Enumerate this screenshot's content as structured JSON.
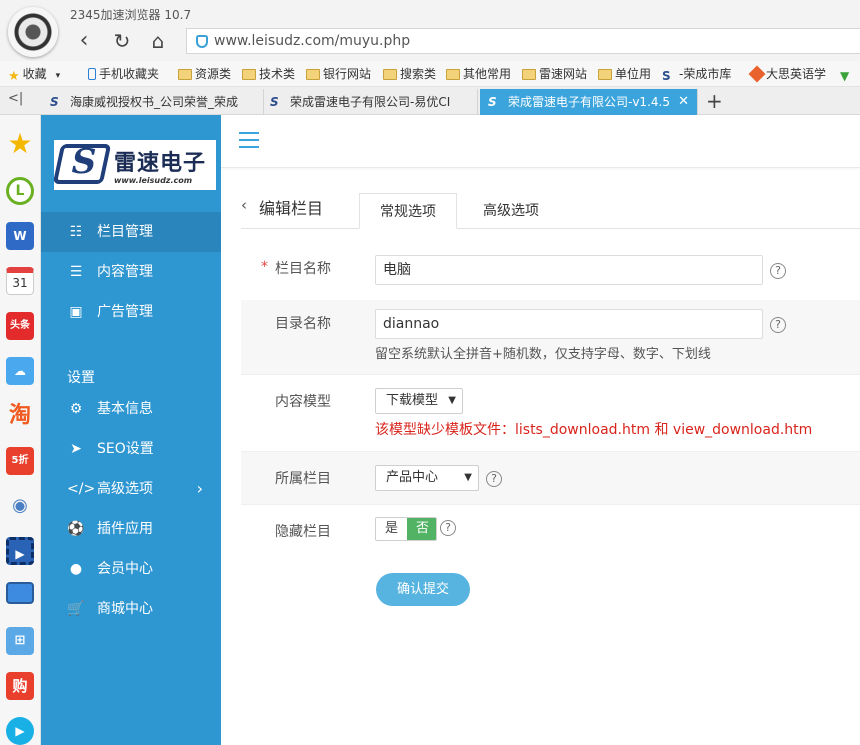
{
  "browser": {
    "title": "2345加速浏览器 10.7",
    "url": "www.leisudz.com/muyu.php"
  },
  "bookmarks": [
    {
      "label": "收藏",
      "icon": "star-icon"
    },
    {
      "label": "手机收藏夹",
      "icon": "phone-icon"
    },
    {
      "label": "资源类",
      "icon": "folder-icon"
    },
    {
      "label": "技术类",
      "icon": "folder-icon"
    },
    {
      "label": "银行网站",
      "icon": "folder-icon"
    },
    {
      "label": "搜索类",
      "icon": "folder-icon"
    },
    {
      "label": "其他常用",
      "icon": "folder-icon"
    },
    {
      "label": "雷速网站",
      "icon": "folder-icon"
    },
    {
      "label": "单位用",
      "icon": "folder-icon"
    },
    {
      "label": "-荣成市库",
      "icon": "site-logo-icon"
    },
    {
      "label": "大思英语学",
      "icon": "diamond-icon"
    }
  ],
  "tabs": [
    {
      "label": "海康威视授权书_公司荣誉_荣成",
      "active": false
    },
    {
      "label": "荣成雷速电子有限公司-易优CI",
      "active": false
    },
    {
      "label": "荣成雷速电子有限公司-v1.4.5",
      "active": true
    }
  ],
  "dock": {
    "calendar_day": "31",
    "toutiao": "头条",
    "taobao": "淘",
    "discount": "5折",
    "shop": "购"
  },
  "brand": {
    "name": "雷速电子",
    "url": "www.leisudz.com"
  },
  "sidebar": {
    "items": [
      {
        "label": "栏目管理",
        "icon": "sitemap-icon",
        "active": true
      },
      {
        "label": "内容管理",
        "icon": "list-icon",
        "active": false
      },
      {
        "label": "广告管理",
        "icon": "image-icon",
        "active": false
      }
    ],
    "section_label": "设置",
    "settings": [
      {
        "label": "基本信息",
        "icon": "gear-icon"
      },
      {
        "label": "SEO设置",
        "icon": "send-icon"
      },
      {
        "label": "高级选项",
        "icon": "code-icon",
        "has_arrow": true
      },
      {
        "label": "插件应用",
        "icon": "puzzle-ball-icon"
      },
      {
        "label": "会员中心",
        "icon": "user-icon"
      },
      {
        "label": "商城中心",
        "icon": "cart-icon"
      }
    ]
  },
  "page": {
    "title": "编辑栏目",
    "tabs": [
      "常规选项",
      "高级选项"
    ]
  },
  "form": {
    "name_label": "栏目名称",
    "name_value": "电脑",
    "dir_label": "目录名称",
    "dir_value": "diannao",
    "dir_hint": "留空系统默认全拼音+随机数，仅支持字母、数字、下划线",
    "model_label": "内容模型",
    "model_value": "下载模型",
    "model_warning": "该模型缺少模板文件：lists_download.htm 和 view_download.htm",
    "parent_label": "所属栏目",
    "parent_value": "产品中心",
    "hidden_label": "隐藏栏目",
    "hidden_yes": "是",
    "hidden_no": "否",
    "hidden_selected": "否",
    "submit_label": "确认提交"
  }
}
